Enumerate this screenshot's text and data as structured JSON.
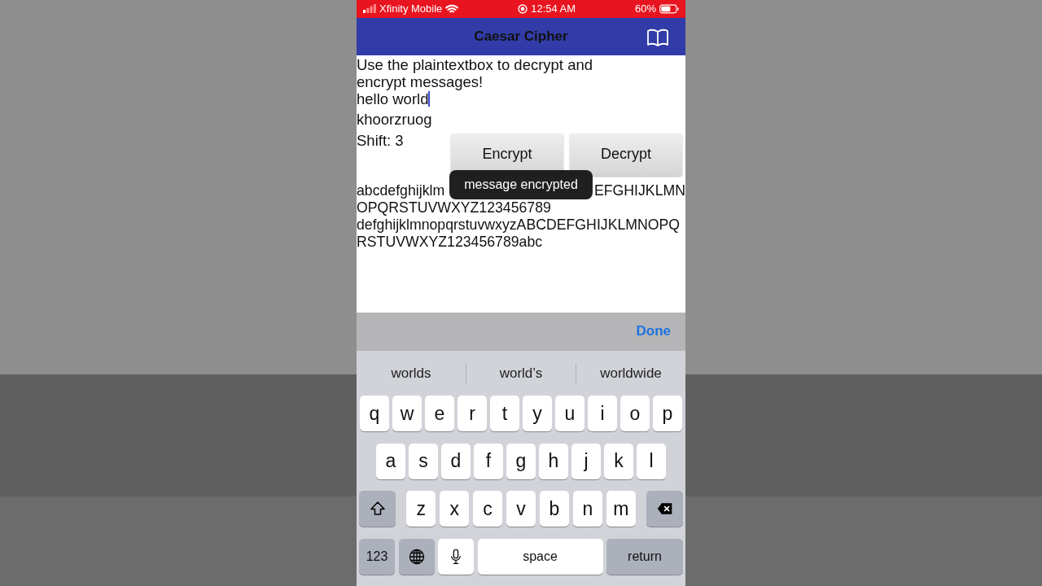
{
  "status_bar": {
    "carrier": "Xfinity Mobile",
    "time": "12:54 AM",
    "battery": "60%"
  },
  "nav_bar": {
    "title": "Caesar Cipher"
  },
  "instructions": "Use the plaintextbox to decrypt and encrypt messages!",
  "plaintext_field": {
    "value": "hello world"
  },
  "ciphertext": "khoorzruog",
  "shift_label": "Shift: 3",
  "buttons": [
    {
      "label": "Encrypt"
    },
    {
      "label": "Decrypt"
    }
  ],
  "alphabet_lines": [
    [
      "abcdefghijklm",
      "EFGHIJKLMN"
    ],
    [
      "OPQRSTUVWXYZ123456789"
    ],
    [
      "defghijklmnopqrstuvwxyzABCDEFGHIJKLMNOPQ"
    ],
    [
      "RSTUVWXYZ123456789abc"
    ]
  ],
  "toast": "message encrypted",
  "keyboard": {
    "toolbar_button": "Done",
    "suggestions": [
      "worlds",
      "world’s",
      "worldwide"
    ],
    "letter_rows": [
      [
        {
          "kind": "letter",
          "label": "q"
        },
        {
          "kind": "letter",
          "label": "w"
        },
        {
          "kind": "letter",
          "label": "e"
        },
        {
          "kind": "letter",
          "label": "r"
        },
        {
          "kind": "letter",
          "label": "t"
        },
        {
          "kind": "letter",
          "label": "y"
        },
        {
          "kind": "letter",
          "label": "u"
        },
        {
          "kind": "letter",
          "label": "i"
        },
        {
          "kind": "letter",
          "label": "o"
        },
        {
          "kind": "letter",
          "label": "p"
        }
      ],
      [
        {
          "kind": "letter",
          "label": "a"
        },
        {
          "kind": "letter",
          "label": "s"
        },
        {
          "kind": "letter",
          "label": "d"
        },
        {
          "kind": "letter",
          "label": "f"
        },
        {
          "kind": "letter",
          "label": "g"
        },
        {
          "kind": "letter",
          "label": "h"
        },
        {
          "kind": "letter",
          "label": "j"
        },
        {
          "kind": "letter",
          "label": "k"
        },
        {
          "kind": "letter",
          "label": "l"
        }
      ],
      [
        {
          "kind": "shift"
        },
        {
          "kind": "letter",
          "label": "z"
        },
        {
          "kind": "letter",
          "label": "x"
        },
        {
          "kind": "letter",
          "label": "c"
        },
        {
          "kind": "letter",
          "label": "v"
        },
        {
          "kind": "letter",
          "label": "b"
        },
        {
          "kind": "letter",
          "label": "n"
        },
        {
          "kind": "letter",
          "label": "m"
        },
        {
          "kind": "delete"
        }
      ]
    ],
    "bottom_keys": [
      {
        "kind": "mode",
        "label": "123"
      },
      {
        "kind": "globe"
      },
      {
        "kind": "mic"
      },
      {
        "kind": "space",
        "label": "space"
      },
      {
        "kind": "return",
        "label": "return"
      }
    ]
  }
}
